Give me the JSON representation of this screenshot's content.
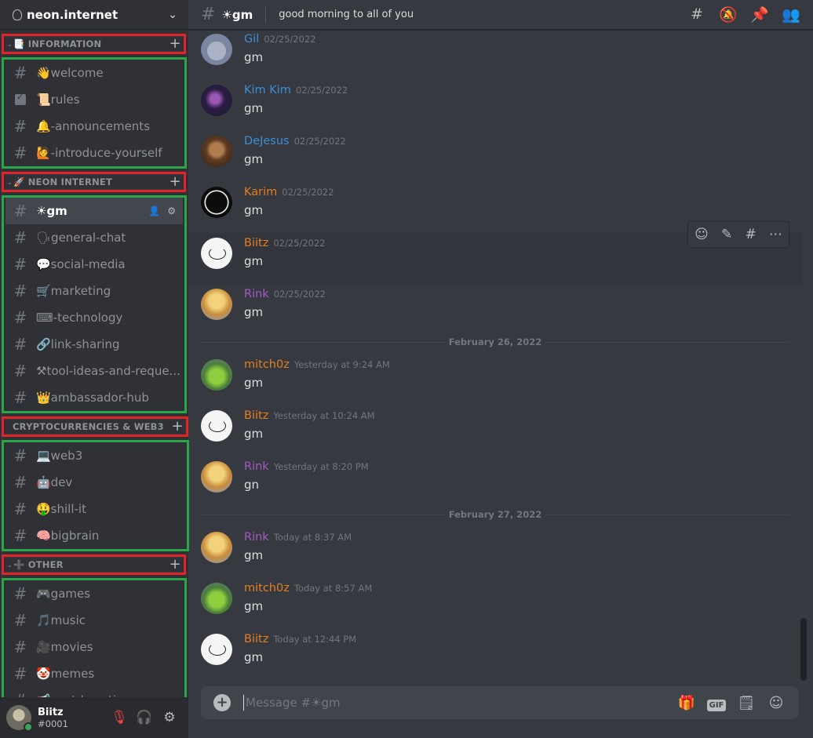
{
  "server": {
    "name": "neon.internet"
  },
  "categories": [
    {
      "label": "📑 INFORMATION",
      "channels": [
        {
          "name": "👋welcome",
          "icon": "hash"
        },
        {
          "name": "📜rules",
          "icon": "rules-checkbox"
        },
        {
          "name": "🔔-announcements",
          "icon": "hash"
        },
        {
          "name": "🙋-introduce-yourself",
          "icon": "hash"
        }
      ]
    },
    {
      "label": "🚀 NEON INTERNET",
      "channels": [
        {
          "name": "☀gm",
          "icon": "hash",
          "active": true
        },
        {
          "name": "🗣general-chat",
          "icon": "hash"
        },
        {
          "name": "💬social-media",
          "icon": "hash"
        },
        {
          "name": "🛒marketing",
          "icon": "hash"
        },
        {
          "name": "⌨-technology",
          "icon": "hash"
        },
        {
          "name": "🔗link-sharing",
          "icon": "hash"
        },
        {
          "name": "⚒tool-ideas-and-reque...",
          "icon": "hash"
        },
        {
          "name": "👑ambassador-hub",
          "icon": "hash"
        }
      ]
    },
    {
      "label": "CRYPTOCURRENCIES & WEB3",
      "channels": [
        {
          "name": "💻web3",
          "icon": "hash"
        },
        {
          "name": "🤖dev",
          "icon": "hash"
        },
        {
          "name": "🤑shill-it",
          "icon": "hash"
        },
        {
          "name": "🧠bigbrain",
          "icon": "hash"
        }
      ]
    },
    {
      "label": "➕ OTHER",
      "channels": [
        {
          "name": "🎮games",
          "icon": "hash"
        },
        {
          "name": "🎵music",
          "icon": "hash"
        },
        {
          "name": "🎥movies",
          "icon": "hash"
        },
        {
          "name": "🤡memes",
          "icon": "hash"
        },
        {
          "name": "📢post-boosting",
          "icon": "hash"
        }
      ]
    }
  ],
  "user": {
    "name": "Biitz",
    "tag": "#0001"
  },
  "channel": {
    "name": "☀gm",
    "topic": "good morning to all of you"
  },
  "messages": [
    {
      "author": "Gil",
      "color": "#3c8fd6",
      "time": "02/25/2022",
      "text": "gm",
      "avatar": "gil"
    },
    {
      "author": "Kim Kim",
      "color": "#3c8fd6",
      "time": "02/25/2022",
      "text": "gm",
      "avatar": "kim"
    },
    {
      "author": "DeJesus",
      "color": "#3c8fd6",
      "time": "02/25/2022",
      "text": "gm",
      "avatar": "dej"
    },
    {
      "author": "Karim",
      "color": "#e67e22",
      "time": "02/25/2022",
      "text": "gm",
      "avatar": "kar"
    },
    {
      "author": "Biitz",
      "color": "#e67e22",
      "time": "02/25/2022",
      "text": "gm",
      "avatar": "biitz"
    },
    {
      "author": "Rink",
      "color": "#a25bc7",
      "time": "02/25/2022",
      "text": "gm",
      "avatar": "rink"
    },
    {
      "author": "mitch0z",
      "color": "#e67e22",
      "time": "Yesterday at 9:24 AM",
      "text": "gm",
      "avatar": "mitch"
    },
    {
      "author": "Biitz",
      "color": "#e67e22",
      "time": "Yesterday at 10:24 AM",
      "text": "gm",
      "avatar": "biitz"
    },
    {
      "author": "Rink",
      "color": "#a25bc7",
      "time": "Yesterday at 8:20 PM",
      "text": "gn",
      "avatar": "rink"
    },
    {
      "author": "Rink",
      "color": "#a25bc7",
      "time": "Today at 8:37 AM",
      "text": "gm",
      "avatar": "rink"
    },
    {
      "author": "mitch0z",
      "color": "#e67e22",
      "time": "Today at 8:57 AM",
      "text": "gm",
      "avatar": "mitch"
    },
    {
      "author": "Biitz",
      "color": "#e67e22",
      "time": "Today at 12:44 PM",
      "text": "gm",
      "avatar": "biitz"
    }
  ],
  "day_dividers": [
    "February 26, 2022",
    "February 27, 2022"
  ],
  "composer": {
    "placeholder": "Message #☀gm"
  },
  "icons": {
    "topbar": [
      "threads-icon",
      "notification-mute-icon",
      "pin-icon",
      "member-list-icon"
    ],
    "hover_toolbar": [
      "add-reaction-icon",
      "edit-icon",
      "create-thread-icon",
      "more-icon"
    ],
    "composer": [
      "gift-icon",
      "gif-icon",
      "sticker-icon",
      "emoji-icon"
    ],
    "user_panel": [
      "microphone-muted-icon",
      "headphones-deafened-icon",
      "settings-icon"
    ]
  }
}
